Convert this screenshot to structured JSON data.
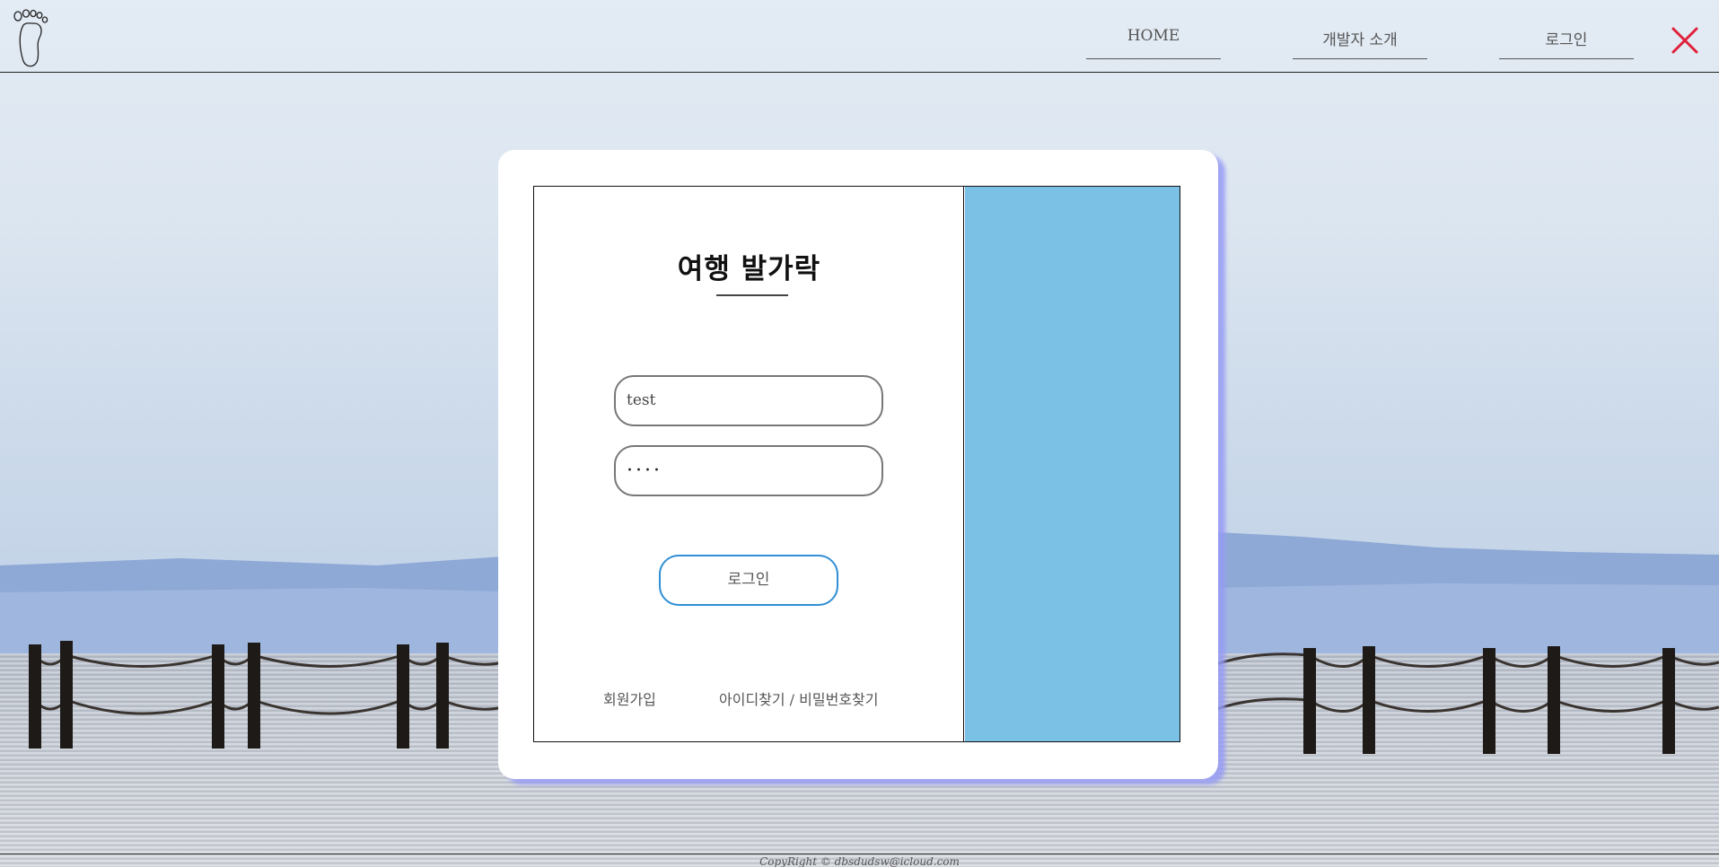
{
  "header": {
    "logo_icon": "footprint-icon",
    "nav": [
      {
        "label": "HOME"
      },
      {
        "label": "개발자 소개"
      },
      {
        "label": "로그인"
      }
    ],
    "close_icon": "close-icon",
    "close_color": "#e0203a"
  },
  "login": {
    "title": "여행 발가락",
    "username_value": "test",
    "password_masked": "····",
    "login_button": "로그인",
    "signup_link": "회원가입",
    "find_link": "아이디찾기 / 비밀번호찾기",
    "accent_color": "#2f8fd6",
    "panel_color": "#7bc1e6"
  },
  "footer": {
    "copyright": "CopyRight © dbsdudsw@icloud.com"
  }
}
